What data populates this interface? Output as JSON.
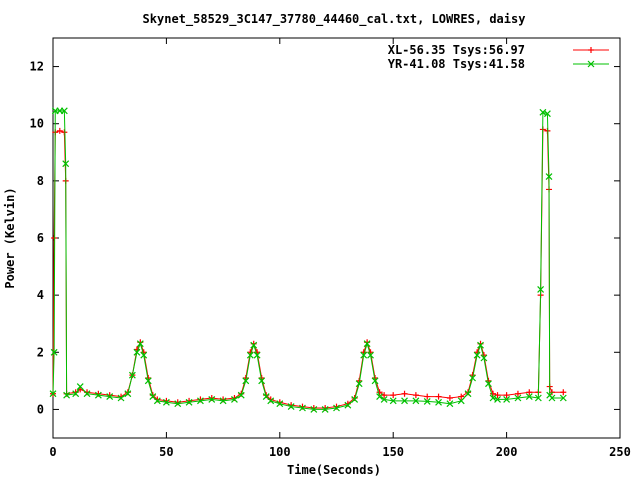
{
  "chart_data": {
    "type": "line",
    "title": "Skynet_58529_3C147_37780_44460_cal.txt, LOWRES, daisy",
    "xlabel": "Time(Seconds)",
    "ylabel": "Power (Kelvin)",
    "xlim": [
      0,
      250
    ],
    "ylim": [
      -1,
      13
    ],
    "xticks": [
      0,
      50,
      100,
      150,
      200,
      250
    ],
    "yticks": [
      0,
      2,
      4,
      6,
      8,
      10,
      12
    ],
    "grid": false,
    "legend_position": "top-right",
    "series": [
      {
        "name": "XL-56.35 Tsys:56.97",
        "color": "#ff0000",
        "marker": "plus",
        "points": [
          [
            0,
            0.55
          ],
          [
            0.5,
            6.0
          ],
          [
            1,
            9.7
          ],
          [
            3,
            9.75
          ],
          [
            5,
            9.7
          ],
          [
            5.6,
            8.0
          ],
          [
            6,
            0.55
          ],
          [
            10,
            0.6
          ],
          [
            12,
            0.7
          ],
          [
            15,
            0.6
          ],
          [
            20,
            0.55
          ],
          [
            25,
            0.5
          ],
          [
            30,
            0.45
          ],
          [
            33,
            0.6
          ],
          [
            35,
            1.2
          ],
          [
            37,
            2.1
          ],
          [
            38.5,
            2.35
          ],
          [
            40,
            2.0
          ],
          [
            42,
            1.1
          ],
          [
            44,
            0.5
          ],
          [
            46,
            0.35
          ],
          [
            50,
            0.3
          ],
          [
            55,
            0.25
          ],
          [
            60,
            0.3
          ],
          [
            65,
            0.35
          ],
          [
            70,
            0.4
          ],
          [
            75,
            0.35
          ],
          [
            80,
            0.4
          ],
          [
            83,
            0.55
          ],
          [
            85,
            1.1
          ],
          [
            87,
            2.0
          ],
          [
            88.5,
            2.3
          ],
          [
            90,
            2.0
          ],
          [
            92,
            1.1
          ],
          [
            94,
            0.5
          ],
          [
            96,
            0.35
          ],
          [
            100,
            0.25
          ],
          [
            105,
            0.15
          ],
          [
            110,
            0.1
          ],
          [
            115,
            0.05
          ],
          [
            120,
            0.05
          ],
          [
            125,
            0.1
          ],
          [
            130,
            0.2
          ],
          [
            133,
            0.4
          ],
          [
            135,
            1.0
          ],
          [
            137,
            2.0
          ],
          [
            138.5,
            2.35
          ],
          [
            140,
            2.0
          ],
          [
            142,
            1.1
          ],
          [
            144,
            0.6
          ],
          [
            146,
            0.5
          ],
          [
            150,
            0.5
          ],
          [
            155,
            0.55
          ],
          [
            160,
            0.5
          ],
          [
            165,
            0.45
          ],
          [
            170,
            0.45
          ],
          [
            175,
            0.4
          ],
          [
            180,
            0.45
          ],
          [
            183,
            0.6
          ],
          [
            185,
            1.2
          ],
          [
            187,
            2.0
          ],
          [
            188.5,
            2.3
          ],
          [
            190,
            1.9
          ],
          [
            192,
            1.0
          ],
          [
            194,
            0.55
          ],
          [
            196,
            0.5
          ],
          [
            200,
            0.5
          ],
          [
            205,
            0.55
          ],
          [
            210,
            0.6
          ],
          [
            214,
            0.6
          ],
          [
            215,
            4.0
          ],
          [
            216,
            9.8
          ],
          [
            218,
            9.75
          ],
          [
            218.7,
            7.7
          ],
          [
            219,
            0.8
          ],
          [
            220,
            0.6
          ],
          [
            225,
            0.6
          ]
        ]
      },
      {
        "name": "YR-41.08 Tsys:41.58",
        "color": "#00c000",
        "marker": "cross",
        "points": [
          [
            0,
            0.55
          ],
          [
            0.5,
            2.0
          ],
          [
            1,
            10.45
          ],
          [
            3,
            10.45
          ],
          [
            5,
            10.45
          ],
          [
            5.6,
            8.6
          ],
          [
            6,
            0.5
          ],
          [
            10,
            0.55
          ],
          [
            12,
            0.8
          ],
          [
            15,
            0.55
          ],
          [
            20,
            0.5
          ],
          [
            25,
            0.45
          ],
          [
            30,
            0.4
          ],
          [
            33,
            0.55
          ],
          [
            35,
            1.2
          ],
          [
            37,
            2.0
          ],
          [
            38.5,
            2.3
          ],
          [
            40,
            1.9
          ],
          [
            42,
            1.0
          ],
          [
            44,
            0.45
          ],
          [
            46,
            0.3
          ],
          [
            50,
            0.25
          ],
          [
            55,
            0.2
          ],
          [
            60,
            0.25
          ],
          [
            65,
            0.3
          ],
          [
            70,
            0.35
          ],
          [
            75,
            0.3
          ],
          [
            80,
            0.35
          ],
          [
            83,
            0.5
          ],
          [
            85,
            1.0
          ],
          [
            87,
            1.9
          ],
          [
            88.5,
            2.25
          ],
          [
            90,
            1.9
          ],
          [
            92,
            1.0
          ],
          [
            94,
            0.45
          ],
          [
            96,
            0.3
          ],
          [
            100,
            0.2
          ],
          [
            105,
            0.1
          ],
          [
            110,
            0.05
          ],
          [
            115,
            0.0
          ],
          [
            120,
            0.0
          ],
          [
            125,
            0.05
          ],
          [
            130,
            0.15
          ],
          [
            133,
            0.35
          ],
          [
            135,
            0.9
          ],
          [
            137,
            1.9
          ],
          [
            138.5,
            2.3
          ],
          [
            140,
            1.9
          ],
          [
            142,
            1.0
          ],
          [
            144,
            0.45
          ],
          [
            146,
            0.35
          ],
          [
            150,
            0.3
          ],
          [
            155,
            0.3
          ],
          [
            160,
            0.3
          ],
          [
            165,
            0.28
          ],
          [
            170,
            0.25
          ],
          [
            175,
            0.2
          ],
          [
            180,
            0.3
          ],
          [
            183,
            0.55
          ],
          [
            185,
            1.1
          ],
          [
            187,
            1.9
          ],
          [
            188.5,
            2.25
          ],
          [
            190,
            1.8
          ],
          [
            192,
            0.9
          ],
          [
            194,
            0.4
          ],
          [
            196,
            0.35
          ],
          [
            200,
            0.35
          ],
          [
            205,
            0.4
          ],
          [
            210,
            0.45
          ],
          [
            214,
            0.4
          ],
          [
            215,
            4.2
          ],
          [
            216,
            10.4
          ],
          [
            218,
            10.35
          ],
          [
            218.7,
            8.15
          ],
          [
            219,
            0.5
          ],
          [
            220,
            0.4
          ],
          [
            225,
            0.4
          ]
        ]
      }
    ]
  }
}
